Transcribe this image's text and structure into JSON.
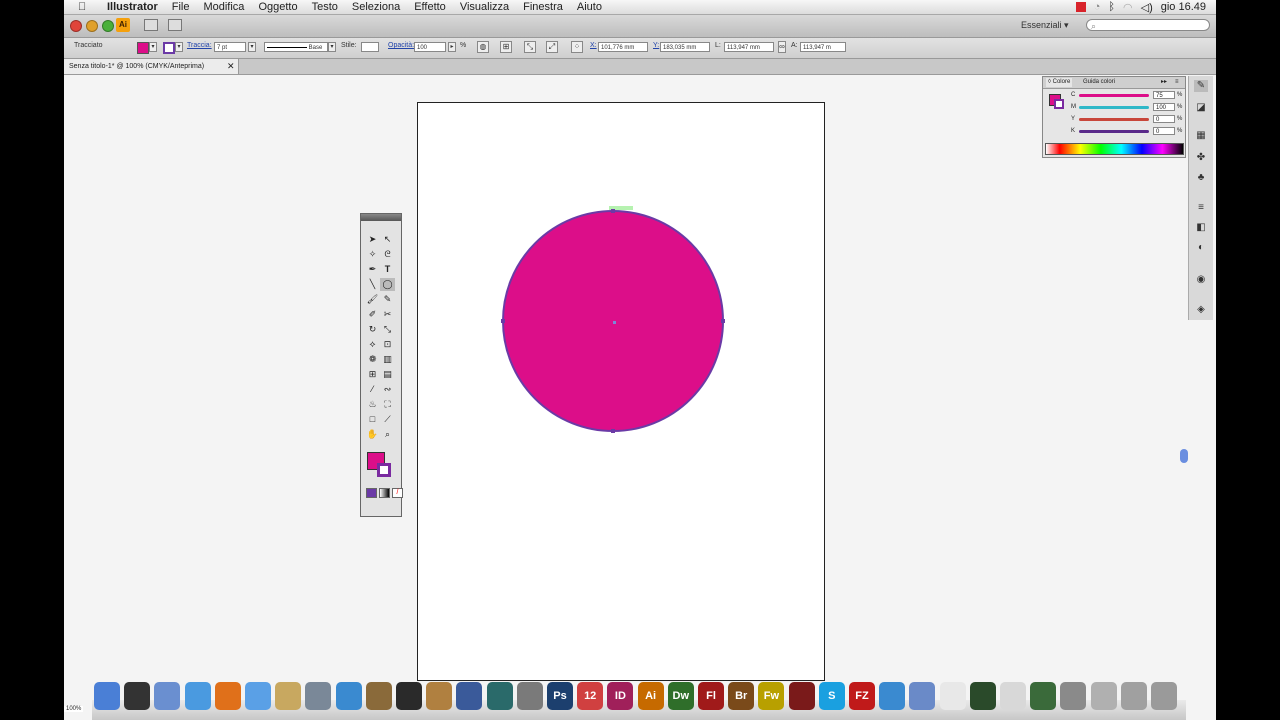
{
  "menubar": {
    "apple": "",
    "app_name": "Illustrator",
    "items": [
      "File",
      "Modifica",
      "Oggetto",
      "Testo",
      "Seleziona",
      "Effetto",
      "Visualizza",
      "Finestra",
      "Aiuto"
    ],
    "clock": "gio 16.49"
  },
  "appbar": {
    "ai_badge": "Ai",
    "workspace": "Essenziali ▾",
    "search_placeholder": "⌕"
  },
  "control": {
    "selection_label": "Tracciato",
    "traccia_label": "Traccia:",
    "stroke_weight": "7 pt",
    "profile": "Base",
    "stile_label": "Stile:",
    "opacity_label": "Opacità:",
    "opacity": "100",
    "pct": "%",
    "x_label": "X:",
    "x_value": "101,776 mm",
    "y_label": "Y:",
    "y_value": "183,035 mm",
    "w_label": "L:",
    "w_value": "113,947 mm",
    "h_label": "A:",
    "h_value": "113,947 m"
  },
  "doc": {
    "tab_title": "Senza titolo-1* @ 100% (CMYK/Anteprima)",
    "close": "✕",
    "zoom": "100%"
  },
  "colorpanel": {
    "tab1": "◊ Colore",
    "tab2": "Guida colori",
    "rows": [
      {
        "label": "C",
        "value": "75",
        "color": "#dc0e89"
      },
      {
        "label": "M",
        "value": "100",
        "color": "#2fb8c8"
      },
      {
        "label": "Y",
        "value": "0",
        "color": "#c8463a"
      },
      {
        "label": "K",
        "value": "0",
        "color": "#5a2a8a"
      }
    ],
    "pct": "%"
  },
  "colors": {
    "fill": "#dc0e89",
    "stroke": "#6b3aa6"
  },
  "dock": {
    "apps": [
      {
        "name": "finder-icon",
        "label": "",
        "color": "#4a7fd6"
      },
      {
        "name": "dashboard-icon",
        "label": "",
        "color": "#333333"
      },
      {
        "name": "mail-icon",
        "label": "",
        "color": "#6a8fd0"
      },
      {
        "name": "safari-icon",
        "label": "",
        "color": "#4a9ae0"
      },
      {
        "name": "firefox-icon",
        "label": "",
        "color": "#e0701a"
      },
      {
        "name": "ichat-icon",
        "label": "",
        "color": "#5aa0e6"
      },
      {
        "name": "address-book-icon",
        "label": "",
        "color": "#c8a860"
      },
      {
        "name": "iphoto-icon",
        "label": "",
        "color": "#7a8898"
      },
      {
        "name": "itunes-icon",
        "label": "",
        "color": "#3a8ad0"
      },
      {
        "name": "imovie-icon",
        "label": "",
        "color": "#8a6a3a"
      },
      {
        "name": "iweb-icon",
        "label": "",
        "color": "#2a2a2a"
      },
      {
        "name": "garageband-icon",
        "label": "",
        "color": "#b08040"
      },
      {
        "name": "spaces-icon",
        "label": "",
        "color": "#3a5a9a"
      },
      {
        "name": "time-machine-icon",
        "label": "",
        "color": "#2a6a6a"
      },
      {
        "name": "system-preferences-icon",
        "label": "",
        "color": "#7a7a7a"
      },
      {
        "name": "photoshop-icon",
        "label": "Ps",
        "color": "#1c3f6e"
      },
      {
        "name": "ical-icon",
        "label": "12",
        "color": "#d04040"
      },
      {
        "name": "indesign-icon",
        "label": "ID",
        "color": "#a0205a"
      },
      {
        "name": "illustrator-icon",
        "label": "Ai",
        "color": "#c66a00"
      },
      {
        "name": "dreamweaver-icon",
        "label": "Dw",
        "color": "#2f6e2a"
      },
      {
        "name": "flash-icon",
        "label": "Fl",
        "color": "#a01a1a"
      },
      {
        "name": "bridge-icon",
        "label": "Br",
        "color": "#7a4a1a"
      },
      {
        "name": "fireworks-icon",
        "label": "Fw",
        "color": "#b8a000"
      },
      {
        "name": "book-icon",
        "label": "",
        "color": "#7a1a1a"
      },
      {
        "name": "skype-icon",
        "label": "S",
        "color": "#1aa0e0"
      },
      {
        "name": "filezilla-icon",
        "label": "FZ",
        "color": "#c01a1a"
      },
      {
        "name": "messenger-icon",
        "label": "",
        "color": "#3a8ad0"
      },
      {
        "name": "folder-icon",
        "label": "",
        "color": "#6a8ac8"
      },
      {
        "name": "textedit-icon",
        "label": "",
        "color": "#e8e8e8"
      },
      {
        "name": "activity-monitor-icon",
        "label": "",
        "color": "#2a4a2a"
      },
      {
        "name": "acrobat-icon",
        "label": "",
        "color": "#d8d8d8"
      },
      {
        "name": "console-icon",
        "label": "",
        "color": "#3a6a3a"
      },
      {
        "name": "preview-icon",
        "label": "",
        "color": "#8a8a8a"
      },
      {
        "name": "documents-icon",
        "label": "",
        "color": "#b0b0b0"
      },
      {
        "name": "downloads-icon",
        "label": "",
        "color": "#a0a0a0"
      },
      {
        "name": "trash-icon",
        "label": "",
        "color": "#9a9a9a"
      }
    ]
  }
}
